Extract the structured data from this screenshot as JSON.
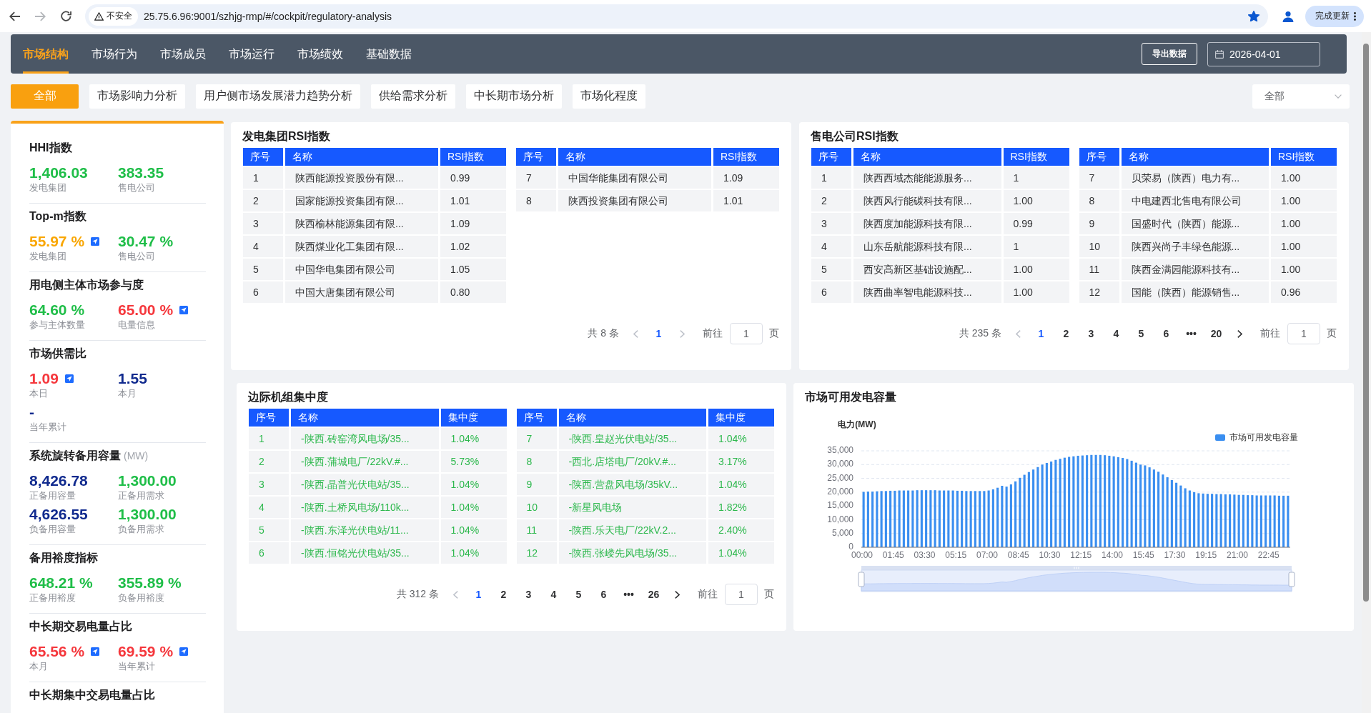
{
  "browser": {
    "forward_disabled": true,
    "security_label": "不安全",
    "url": "25.75.6.96:9001/szhjg-rmp/#/cockpit/regulatory-analysis",
    "bookmarked": true,
    "update_button": "完成更新"
  },
  "nav": {
    "tabs": [
      {
        "label": "市场结构",
        "selected": true
      },
      {
        "label": "市场行为",
        "selected": false
      },
      {
        "label": "市场成员",
        "selected": false
      },
      {
        "label": "市场运行",
        "selected": false
      },
      {
        "label": "市场绩效",
        "selected": false
      },
      {
        "label": "基础数据",
        "selected": false
      }
    ],
    "export_button": "导出数据",
    "date": "2026-04-01"
  },
  "filters": {
    "chips": [
      {
        "label": "全部",
        "selected": true
      },
      {
        "label": "市场影响力分析",
        "selected": false
      },
      {
        "label": "用户侧市场发展潜力趋势分析",
        "selected": false
      },
      {
        "label": "供给需求分析",
        "selected": false
      },
      {
        "label": "中长期市场分析",
        "selected": false
      },
      {
        "label": "市场化程度",
        "selected": false
      }
    ],
    "dropdown": "全部"
  },
  "metrics": [
    {
      "title": "HHI指数",
      "items": [
        {
          "value": "1,406.03",
          "label": "发电集团",
          "color": "#1fbe48",
          "detail_link": false
        },
        {
          "value": "383.35",
          "label": "售电公司",
          "color": "#1fbe48",
          "detail_link": false
        }
      ]
    },
    {
      "title": "Top-m指数",
      "items": [
        {
          "value": "55.97 %",
          "label": "发电集团",
          "color": "#f9a602",
          "detail_link": true
        },
        {
          "value": "30.47 %",
          "label": "售电公司",
          "color": "#1fbe48",
          "detail_link": false
        }
      ]
    },
    {
      "title": "用电侧主体市场参与度",
      "items": [
        {
          "value": "64.60 %",
          "label": "参与主体数量",
          "color": "#1fbe48",
          "detail_link": false
        },
        {
          "value": "65.00 %",
          "label": "电量信息",
          "color": "#f5373c",
          "detail_link": true
        }
      ]
    },
    {
      "title": "市场供需比",
      "items": [
        {
          "value": "1.09",
          "label": "本日",
          "color": "#f5373c",
          "detail_link": true
        },
        {
          "value": "1.55",
          "label": "本月",
          "color": "#102a8e",
          "detail_link": false
        },
        {
          "value": "-",
          "label": "当年累计",
          "color": "#102a8e",
          "detail_link": false
        }
      ]
    },
    {
      "title": "系统旋转备用容量",
      "unit": "(MW)",
      "items": [
        {
          "value": "8,426.78",
          "label": "正备用容量",
          "color": "#102a8e",
          "detail_link": false
        },
        {
          "value": "1,300.00",
          "label": "正备用需求",
          "color": "#1fbe48",
          "detail_link": false
        },
        {
          "value": "4,626.55",
          "label": "负备用容量",
          "color": "#102a8e",
          "detail_link": false
        },
        {
          "value": "1,300.00",
          "label": "负备用需求",
          "color": "#1fbe48",
          "detail_link": false
        }
      ]
    },
    {
      "title": "备用裕度指标",
      "items": [
        {
          "value": "648.21 %",
          "label": "正备用裕度",
          "color": "#1fbe48",
          "detail_link": false
        },
        {
          "value": "355.89 %",
          "label": "负备用裕度",
          "color": "#1fbe48",
          "detail_link": false
        }
      ]
    },
    {
      "title": "中长期交易电量占比",
      "items": [
        {
          "value": "65.56 %",
          "label": "本月",
          "color": "#f5373c",
          "detail_link": true
        },
        {
          "value": "69.59 %",
          "label": "当年累计",
          "color": "#f5373c",
          "detail_link": true
        }
      ]
    },
    {
      "title": "中长期集中交易电量占比"
    }
  ],
  "panels": [
    {
      "kind": "rsi_table",
      "title": "发电集团RSI指数",
      "tables": [
        {
          "columns": [
            "序号",
            "名称",
            "RSI指数"
          ],
          "rows": [
            [
              "1",
              "陕西能源投资股份有限...",
              "0.99"
            ],
            [
              "2",
              "国家能源投资集团有限...",
              "1.01"
            ],
            [
              "3",
              "陕西榆林能源集团有限...",
              "1.09"
            ],
            [
              "4",
              "陕西煤业化工集团有限...",
              "1.02"
            ],
            [
              "5",
              "中国华电集团有限公司",
              "1.05"
            ],
            [
              "6",
              "中国大唐集团有限公司",
              "0.80"
            ]
          ]
        },
        {
          "columns": [
            "序号",
            "名称",
            "RSI指数"
          ],
          "rows": [
            [
              "7",
              "中国华能集团有限公司",
              "1.09"
            ],
            [
              "8",
              "陕西投资集团有限公司",
              "1.01"
            ]
          ]
        }
      ],
      "pagination": {
        "total": "共 8 条",
        "prev_disabled": true,
        "pages": [
          {
            "label": "1",
            "selected": true
          }
        ],
        "next_disabled": true,
        "goto_label": "前往",
        "goto_value": "1",
        "goto_suffix": "页"
      }
    },
    {
      "kind": "rsi_table",
      "title": "售电公司RSI指数",
      "tables": [
        {
          "columns": [
            "序号",
            "名称",
            "RSI指数"
          ],
          "rows": [
            [
              "1",
              "陕西西域杰能能源服务...",
              "1"
            ],
            [
              "2",
              "陕西风行能碳科技有限...",
              "1.00"
            ],
            [
              "3",
              "陕西度加能源科技有限...",
              "0.99"
            ],
            [
              "4",
              "山东岳航能源科技有限...",
              "1"
            ],
            [
              "5",
              "西安高新区基础设施配...",
              "1.00"
            ],
            [
              "6",
              "陕西曲率智电能源科技...",
              "1.00"
            ]
          ]
        },
        {
          "columns": [
            "序号",
            "名称",
            "RSI指数"
          ],
          "rows": [
            [
              "7",
              "贝荣易（陕西）电力有...",
              "1.00"
            ],
            [
              "8",
              "中电建西北售电有限公司",
              "1.00"
            ],
            [
              "9",
              "国盛时代（陕西）能源...",
              "1.00"
            ],
            [
              "10",
              "陕西兴尚子丰绿色能源...",
              "1.00"
            ],
            [
              "11",
              "陕西金满园能源科技有...",
              "1.00"
            ],
            [
              "12",
              "国能（陕西）能源销售...",
              "0.96"
            ]
          ]
        }
      ],
      "pagination": {
        "total": "共 235 条",
        "prev_disabled": true,
        "pages": [
          {
            "label": "1",
            "selected": true
          },
          {
            "label": "2",
            "selected": false
          },
          {
            "label": "3",
            "selected": false
          },
          {
            "label": "4",
            "selected": false
          },
          {
            "label": "5",
            "selected": false
          },
          {
            "label": "6",
            "selected": false
          },
          {
            "label": "•••",
            "selected": false
          },
          {
            "label": "20",
            "selected": false
          }
        ],
        "next_disabled": false,
        "goto_label": "前往",
        "goto_value": "1",
        "goto_suffix": "页"
      }
    },
    {
      "kind": "concentration_table",
      "title": "边际机组集中度",
      "tables": [
        {
          "columns": [
            "序号",
            "名称",
            "集中度"
          ],
          "rows": [
            [
              "1",
              "-陕西.砖窑湾风电场/35...",
              "1.04%"
            ],
            [
              "2",
              "-陕西.蒲城电厂/22kV.#...",
              "5.73%"
            ],
            [
              "3",
              "-陕西.晶普光伏电站/35...",
              "1.04%"
            ],
            [
              "4",
              "-陕西.土桥风电场/110k...",
              "1.04%"
            ],
            [
              "5",
              "-陕西.东泽光伏电站/11...",
              "1.04%"
            ],
            [
              "6",
              "-陕西.恒铭光伏电站/35...",
              "1.04%"
            ]
          ]
        },
        {
          "columns": [
            "序号",
            "名称",
            "集中度"
          ],
          "rows": [
            [
              "7",
              "-陕西.皇赵光伏电站/35...",
              "1.04%"
            ],
            [
              "8",
              "-西北.店塔电厂/20kV.#...",
              "3.17%"
            ],
            [
              "9",
              "-陕西.营盘风电场/35kV...",
              "1.04%"
            ],
            [
              "10",
              "-新星风电场",
              "1.82%"
            ],
            [
              "11",
              "-陕西.乐天电厂/22kV.2...",
              "2.40%"
            ],
            [
              "12",
              "-陕西.张嵝先风电场/35...",
              "1.04%"
            ]
          ]
        }
      ],
      "pagination": {
        "total": "共 312 条",
        "prev_disabled": true,
        "pages": [
          {
            "label": "1",
            "selected": true
          },
          {
            "label": "2",
            "selected": false
          },
          {
            "label": "3",
            "selected": false
          },
          {
            "label": "4",
            "selected": false
          },
          {
            "label": "5",
            "selected": false
          },
          {
            "label": "6",
            "selected": false
          },
          {
            "label": "•••",
            "selected": false
          },
          {
            "label": "26",
            "selected": false
          }
        ],
        "next_disabled": false,
        "goto_label": "前往",
        "goto_value": "1",
        "goto_suffix": "页"
      }
    },
    {
      "kind": "chart",
      "title": "市场可用发电容量",
      "chart_data": {
        "type": "bar",
        "ylabel": "电力(MW)",
        "grid": true,
        "x": [
          0,
          0.25,
          0.5,
          0.75,
          1,
          1.25,
          1.5,
          1.75,
          2,
          2.25,
          2.5,
          2.75,
          3,
          3.25,
          3.5,
          3.75,
          4,
          4.25,
          4.5,
          4.75,
          5,
          5.25,
          5.5,
          5.75,
          6,
          6.25,
          6.5,
          6.75,
          7,
          7.25,
          7.5,
          7.75,
          8,
          8.25,
          8.5,
          8.75,
          9,
          9.25,
          9.5,
          9.75,
          10,
          10.25,
          10.5,
          10.75,
          11,
          11.25,
          11.5,
          11.75,
          12,
          12.25,
          12.5,
          12.75,
          13,
          13.25,
          13.5,
          13.75,
          14,
          14.25,
          14.5,
          14.75,
          15,
          15.25,
          15.5,
          15.75,
          16,
          16.25,
          16.5,
          16.75,
          17,
          17.25,
          17.5,
          17.75,
          18,
          18.25,
          18.5,
          18.75,
          19,
          19.25,
          19.5,
          19.75,
          20,
          20.25,
          20.5,
          20.75,
          21,
          21.25,
          21.5,
          21.75,
          22,
          22.25,
          22.5,
          22.75,
          23,
          23.25,
          23.5,
          23.75
        ],
        "xlim": [
          0,
          24
        ],
        "xticks": [
          {
            "value": 0,
            "label": "00:00"
          },
          {
            "value": 1.75,
            "label": "01:45"
          },
          {
            "value": 3.5,
            "label": "03:30"
          },
          {
            "value": 5.25,
            "label": "05:15"
          },
          {
            "value": 7,
            "label": "07:00"
          },
          {
            "value": 8.75,
            "label": "08:45"
          },
          {
            "value": 10.5,
            "label": "10:30"
          },
          {
            "value": 12.25,
            "label": "12:15"
          },
          {
            "value": 14,
            "label": "14:00"
          },
          {
            "value": 15.75,
            "label": "15:45"
          },
          {
            "value": 17.5,
            "label": "17:30"
          },
          {
            "value": 19.25,
            "label": "19:15"
          },
          {
            "value": 21,
            "label": "21:00"
          },
          {
            "value": 22.75,
            "label": "22:45"
          }
        ],
        "ylim": [
          0,
          35000
        ],
        "yticks": [
          0,
          {
            "value": 5000,
            "label": "5,000"
          },
          {
            "value": 10000,
            "label": "10,000"
          },
          {
            "value": 15000,
            "label": "15,000"
          },
          {
            "value": 20000,
            "label": "20,000"
          },
          {
            "value": 25000,
            "label": "25,000"
          },
          {
            "value": 30000,
            "label": "30,000"
          },
          {
            "value": 35000,
            "label": "35,000"
          }
        ],
        "series": [
          {
            "name": "市场可用发电容量",
            "color": "#3a8ef0",
            "values": [
              20100,
              20200,
              20200,
              20300,
              20400,
              20400,
              20500,
              20500,
              20600,
              20600,
              20600,
              20600,
              20700,
              20700,
              20700,
              20700,
              20700,
              20600,
              20600,
              20600,
              20600,
              20500,
              20500,
              20400,
              20400,
              20400,
              20400,
              20400,
              20600,
              21000,
              21600,
              22300,
              22000,
              22800,
              23900,
              25200,
              26300,
              27300,
              28200,
              29100,
              30000,
              30600,
              31100,
              31700,
              32100,
              32500,
              32800,
              33000,
              33200,
              33300,
              33400,
              33500,
              33500,
              33500,
              33400,
              33200,
              33000,
              32700,
              32400,
              32000,
              31400,
              30700,
              30000,
              29700,
              29000,
              28200,
              27400,
              26400,
              25400,
              24400,
              23400,
              22400,
              21400,
              20600,
              20000,
              19600,
              19500,
              19400,
              19400,
              19300,
              19300,
              19200,
              19200,
              19100,
              19000,
              19000,
              18900,
              18900,
              18800,
              18800,
              18800,
              18800,
              18800,
              18700,
              18700,
              18700
            ]
          }
        ]
      }
    }
  ]
}
